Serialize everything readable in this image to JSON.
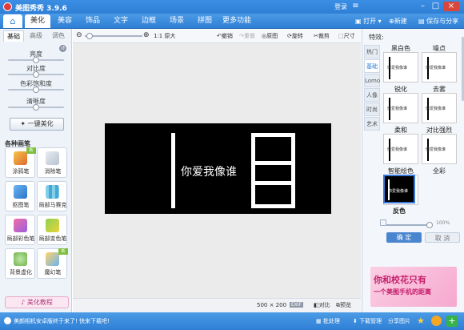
{
  "title": {
    "app": "美图秀秀  3.9.6",
    "login": "登录"
  },
  "menu": {
    "tabs": [
      "美化",
      "美容",
      "饰品",
      "文字",
      "边框",
      "场景",
      "拼图",
      "更多功能"
    ],
    "open": "打开",
    "new": "新建",
    "save": "保存与分享"
  },
  "left": {
    "tabs": [
      "基础",
      "高级",
      "调色"
    ],
    "sliders": [
      {
        "label": "亮度",
        "value": 0.5
      },
      {
        "label": "对比度",
        "value": 0.5
      },
      {
        "label": "色彩饱和度",
        "value": 0.5
      },
      {
        "label": "清晰度",
        "value": 0.5
      }
    ],
    "onekey": "一键美化",
    "brush_title": "各种画笔",
    "brushes": [
      "涂鸦笔",
      "消除笔",
      "抠图笔",
      "局部马赛克",
      "局部彩色笔",
      "局部变色笔",
      "背景虚化",
      "魔幻笔"
    ],
    "badge_new": "新",
    "tutorial": "美化教程"
  },
  "toolbar": {
    "ratio": "1:1 原大",
    "undo": "撤销",
    "redo": "重做",
    "original": "原图",
    "rotate": "旋转",
    "crop": "裁剪",
    "size": "尺寸"
  },
  "canvas": {
    "caption": "你爱我像谁"
  },
  "status": {
    "dims": "500 × 200",
    "exif": "EXIF",
    "compare": "对比",
    "preview": "预览"
  },
  "right": {
    "title": "特效:",
    "tabs": [
      "热门",
      "基础",
      "Lomo",
      "人像",
      "时尚",
      "艺术"
    ],
    "effects": [
      "黑白色",
      "噪点",
      "锐化",
      "去雾",
      "柔和",
      "对比强烈",
      "智能绘色",
      "全彩",
      "反色"
    ],
    "thumb_text": "你爱我像谁",
    "intensity": "100%",
    "ok": "确 定",
    "cancel": "取 消",
    "ad_line1": "你和校花只有",
    "ad_line2": "一个美图手机的距离"
  },
  "bottom": {
    "notice": "美颜相机安卓版终于来了! 快来下载吧!",
    "batch": "批处理",
    "download": "下载管理",
    "share": "分享图片"
  }
}
